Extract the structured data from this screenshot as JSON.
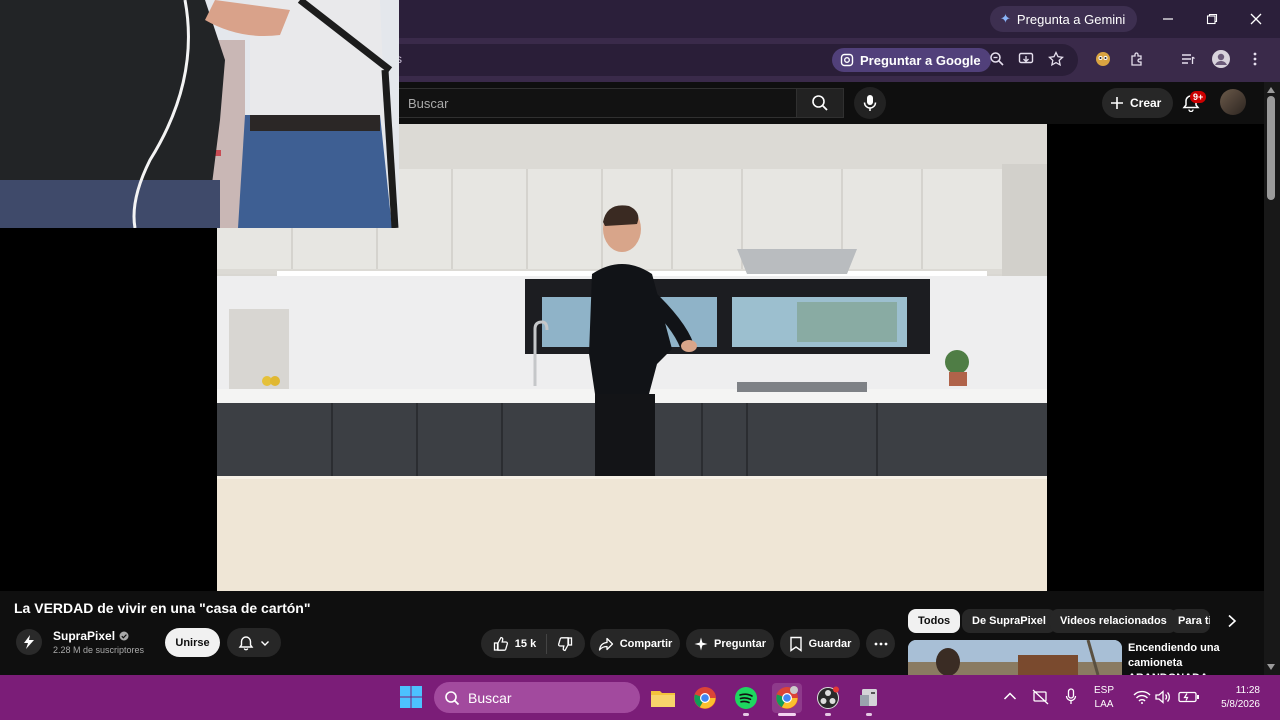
{
  "browser": {
    "gemini_label": "Pregunta a Gemini",
    "ask_google_label": "Preguntar a Google",
    "tab_fragment": "s"
  },
  "youtube": {
    "search_placeholder": "Buscar",
    "create_label": "Crear",
    "notifications_badge": "9+"
  },
  "video": {
    "title": "La VERDAD de vivir en una \"casa de cartón\"",
    "channel": "SupraPixel",
    "subscribers": "2.28 M de suscriptores",
    "join_label": "Unirse",
    "likes": "15 k",
    "share_label": "Compartir",
    "ask_label": "Preguntar",
    "save_label": "Guardar"
  },
  "chips": [
    "Todos",
    "De SupraPixel",
    "Videos relacionados",
    "Para ti"
  ],
  "recommendation": {
    "title": "Encendiendo una camioneta ABANDONADA"
  },
  "taskbar": {
    "search_placeholder": "Buscar",
    "lang_line1": "ESP",
    "lang_line2": "LAA",
    "time": "11:28",
    "date": "5/8/2026"
  },
  "colors": {
    "titlebar": "#2b1f3a",
    "toolbar": "#3a2a4a",
    "taskbar": "#7b1d78",
    "yt_bg": "#0f0f0f"
  }
}
